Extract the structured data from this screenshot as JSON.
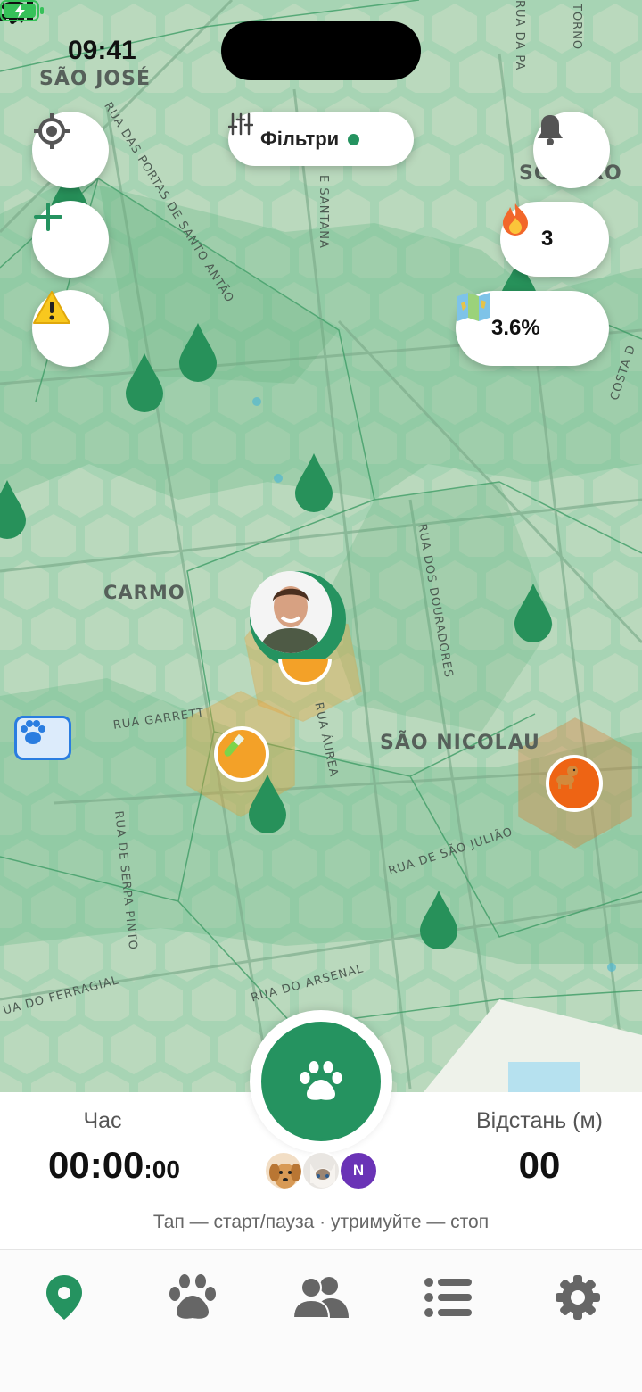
{
  "status_bar": {
    "time": "09:41"
  },
  "map": {
    "districts": [
      "SÃO JOSÉ",
      "CARMO",
      "SÃO NICOLAU",
      "SO",
      "RO"
    ],
    "streets": [
      "RUA DAS PORTAS DE SANTO ANTÃO",
      "E SANTANA",
      "RUA DOS DOURADORES",
      "RUA GARRETT",
      "RUA ÁUREA",
      "RUA DE SÃO JULIÃO",
      "RUA DE SERPA PINTO",
      "RUA DO ARSENAL",
      "UA DO FERRAGIAL",
      "RUA DA PA",
      "COSTA D",
      "TORNO"
    ]
  },
  "controls": {
    "filter_label": "Фільтри",
    "streak_value": "3",
    "coverage_value": "3.6%"
  },
  "walk": {
    "time_label": "Час",
    "time_value": "00:00",
    "time_fraction": ":00",
    "distance_label": "Відстань (м)",
    "distance_value": "00",
    "hint": "Тап — старт/пауза · утримуйте — стоп",
    "extra_pet_initial": "N"
  },
  "colors": {
    "accent": "#259360",
    "zone_orange": "#f0a030",
    "streak_fire": "#f2672a"
  },
  "icons": [
    "locate-icon",
    "plus-icon",
    "warning-icon",
    "filter-icon",
    "bell-icon",
    "fire-icon",
    "map-icon",
    "paw-icon",
    "pin-icon",
    "group-icon",
    "list-icon",
    "gear-icon"
  ]
}
